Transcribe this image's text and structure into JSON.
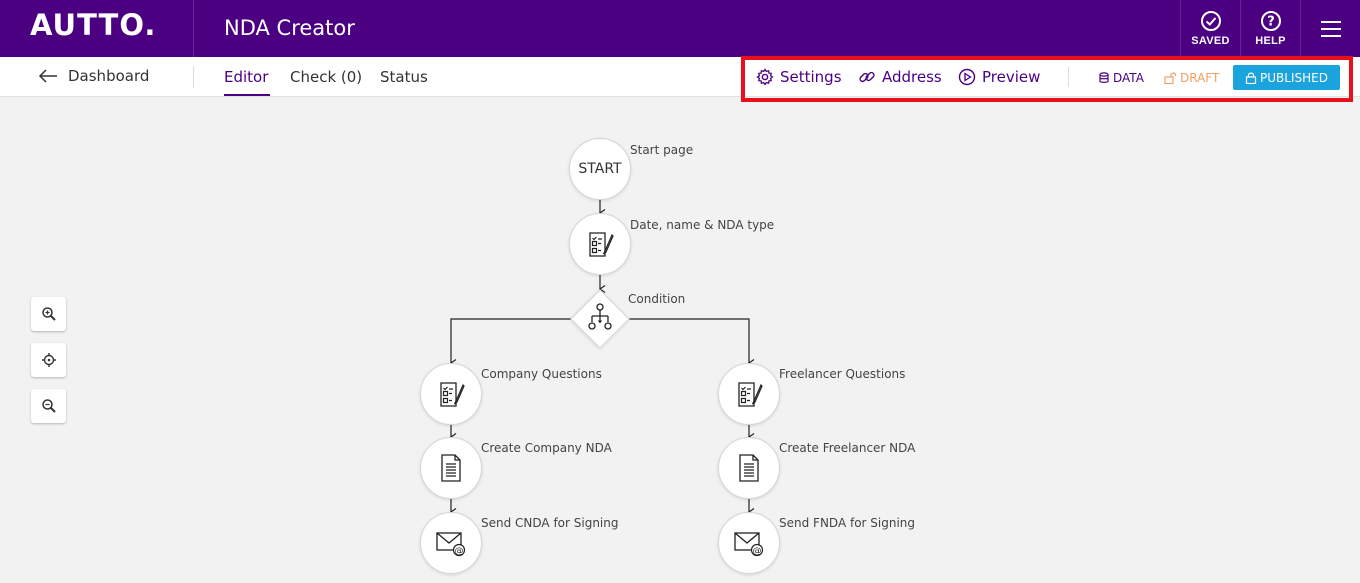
{
  "header": {
    "logo": "AUTTO.",
    "app_title": "NDA Creator",
    "saved_label": "SAVED",
    "help_label": "HELP"
  },
  "subnav": {
    "back_label": "Dashboard",
    "tabs": [
      {
        "label": "Editor",
        "active": true
      },
      {
        "label": "Check (0)",
        "active": false
      },
      {
        "label": "Status",
        "active": false
      }
    ],
    "tools": [
      {
        "label": "Settings",
        "icon": "gear-icon"
      },
      {
        "label": "Address",
        "icon": "link-icon"
      },
      {
        "label": "Preview",
        "icon": "play-circle-icon"
      }
    ],
    "status": {
      "data_label": "DATA",
      "draft_label": "DRAFT",
      "published_label": "PUBLISHED"
    }
  },
  "colors": {
    "brand": "#4b0082",
    "published": "#1aa3dc",
    "draft": "#f0a060",
    "highlight": "#e8101a"
  },
  "zoom_controls": [
    "zoom-in-icon",
    "crosshair-icon",
    "zoom-out-icon"
  ],
  "flow": {
    "start": {
      "text": "START",
      "label": "Start page"
    },
    "step1": {
      "label": "Date, name & NDA type",
      "icon": "form-icon"
    },
    "condition": {
      "label": "Condition",
      "icon": "branch-icon"
    },
    "left": [
      {
        "label": "Company Questions",
        "icon": "form-icon"
      },
      {
        "label": "Create Company NDA",
        "icon": "document-icon"
      },
      {
        "label": "Send CNDA for Signing",
        "icon": "email-icon"
      }
    ],
    "right": [
      {
        "label": "Freelancer Questions",
        "icon": "form-icon"
      },
      {
        "label": "Create Freelancer NDA",
        "icon": "document-icon"
      },
      {
        "label": "Send FNDA for Signing",
        "icon": "email-icon"
      }
    ]
  }
}
